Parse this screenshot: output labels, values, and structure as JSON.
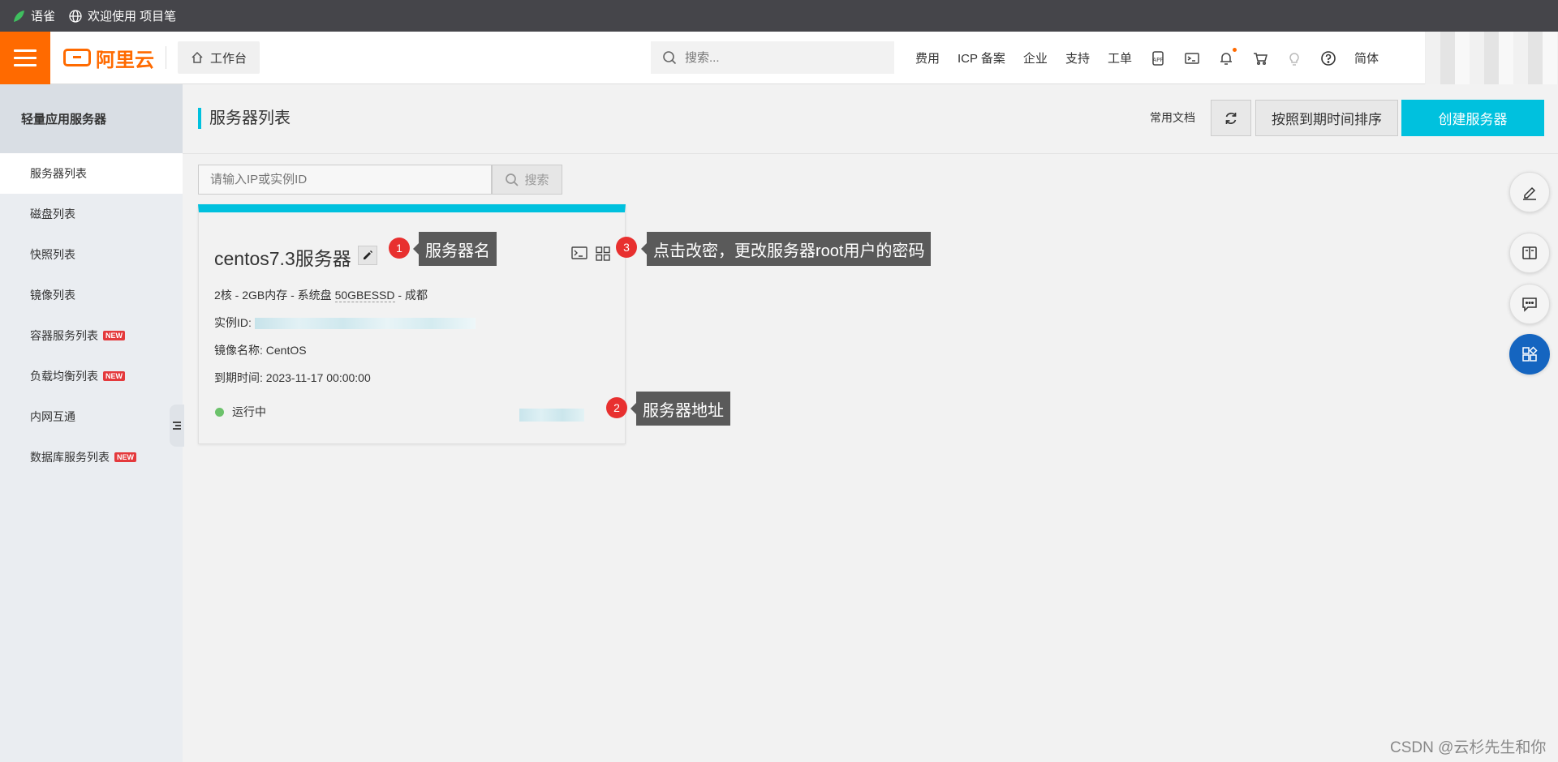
{
  "bookmarks": [
    {
      "label": "语雀",
      "icon": "leaf-icon"
    },
    {
      "label": "欢迎使用 项目笔",
      "icon": "globe-icon"
    }
  ],
  "topnav": {
    "logo_text": "阿里云",
    "workbench_label": "工作台",
    "search_placeholder": "搜索...",
    "links": [
      "费用",
      "ICP 备案",
      "企业",
      "支持",
      "工单"
    ],
    "language": "简体",
    "accent_color": "#ff6a00"
  },
  "sidebar": {
    "title": "轻量应用服务器",
    "items": [
      {
        "label": "服务器列表",
        "active": true,
        "new": false
      },
      {
        "label": "磁盘列表",
        "active": false,
        "new": false
      },
      {
        "label": "快照列表",
        "active": false,
        "new": false
      },
      {
        "label": "镜像列表",
        "active": false,
        "new": false
      },
      {
        "label": "容器服务列表",
        "active": false,
        "new": true
      },
      {
        "label": "负载均衡列表",
        "active": false,
        "new": true
      },
      {
        "label": "内网互通",
        "active": false,
        "new": false
      },
      {
        "label": "数据库服务列表",
        "active": false,
        "new": true
      }
    ],
    "new_badge": "NEW"
  },
  "main": {
    "title": "服务器列表",
    "docs_link": "常用文档",
    "sort_button": "按照到期时间排序",
    "create_button": "创建服务器",
    "ip_placeholder": "请输入IP或实例ID",
    "search_button": "搜索",
    "accent_color": "#00c1de"
  },
  "server": {
    "name": "centos7.3服务器",
    "spec_prefix": "2核 - 2GB内存 - 系统盘 ",
    "spec_disk": "50GBESSD",
    "spec_suffix": " - 成都",
    "instance_label": "实例ID:",
    "image_label": "镜像名称:",
    "image_value": "CentOS",
    "expiry_label": "到期时间:",
    "expiry_value": "2023-11-17 00:00:00",
    "status": "运行中",
    "status_color": "#6cc26b"
  },
  "annotations": [
    {
      "num": "1",
      "text": "服务器名"
    },
    {
      "num": "2",
      "text": "服务器地址"
    },
    {
      "num": "3",
      "text": "点击改密，更改服务器root用户的密码"
    }
  ],
  "watermark": "CSDN @云杉先生和你"
}
